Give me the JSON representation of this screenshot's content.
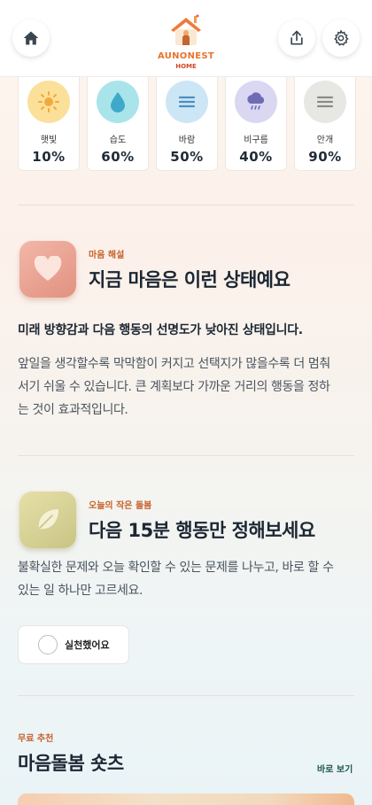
{
  "header": {
    "logo_title": "AUNONEST",
    "logo_sub": "HOME"
  },
  "weather": [
    {
      "label": "햇빛",
      "value": "10%",
      "icon": "sun-icon",
      "color": "#fbe09a"
    },
    {
      "label": "습도",
      "value": "60%",
      "icon": "water-drop-icon",
      "color": "#a9e4ea"
    },
    {
      "label": "바람",
      "value": "50%",
      "icon": "wind-icon",
      "color": "#cde6f6"
    },
    {
      "label": "비구름",
      "value": "40%",
      "icon": "rain-cloud-icon",
      "color": "#d9d7f2"
    },
    {
      "label": "안개",
      "value": "90%",
      "icon": "fog-icon",
      "color": "#e7e7e4"
    }
  ],
  "mind": {
    "eyebrow": "마음 해설",
    "title": "지금 마음은 이런 상태예요",
    "lead": "미래 방향감과 다음 행동의 선명도가 낮아진 상태입니다.",
    "body_lines": [
      "앞일을 생각할수록 막막함이 커지고 선택지가 많을수록 더 멈춰",
      "서기 쉬울 수 있습니다. 큰 계획보다 가까운 거리의 행동을 정하",
      "는 것이 효과적입니다."
    ]
  },
  "care": {
    "eyebrow": "오늘의 작은 돌봄",
    "title": "다음 15분 행동만 정해보세요",
    "body_lines": [
      "불확실한 문제와 오늘 확인할 수 있는 문제를 나누고, 바로 할 수",
      "있는 일 하나만 고르세요."
    ],
    "done_label": "실천했어요"
  },
  "shorts": {
    "eyebrow": "무료 추천",
    "title": "마음돌봄 숏츠",
    "see_all": "바로 보기"
  }
}
